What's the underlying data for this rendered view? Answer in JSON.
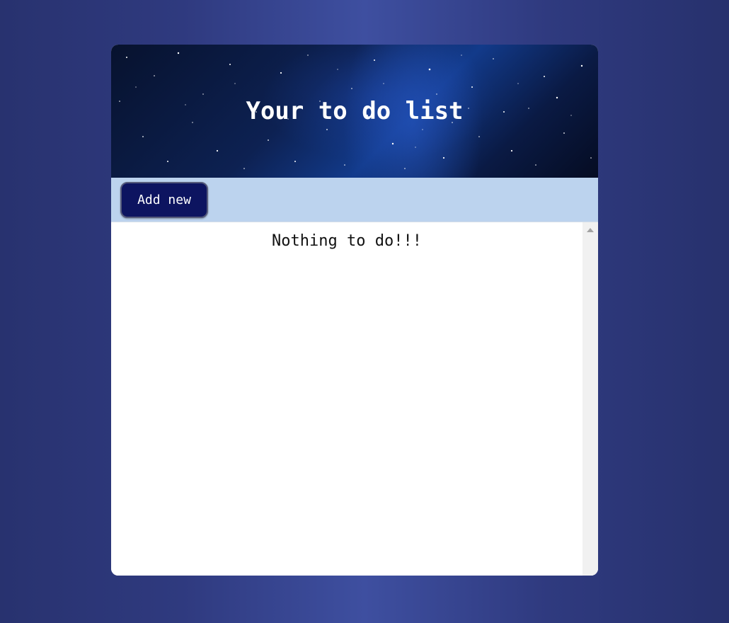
{
  "header": {
    "title": "Your to do list"
  },
  "toolbar": {
    "add_label": "Add new"
  },
  "list": {
    "empty_message": "Nothing to do!!!"
  },
  "icons": {
    "scroll_up": "scroll-up-arrow-icon"
  },
  "colors": {
    "toolbar_bg": "#bcd3ee",
    "button_bg": "#0d1460",
    "page_bg": "#2f3a7f"
  }
}
